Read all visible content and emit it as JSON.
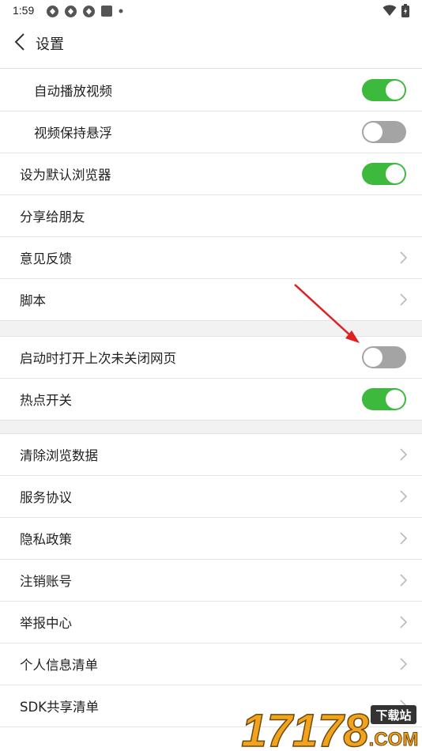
{
  "status_bar": {
    "time": "1:59",
    "left_icons": [
      "app-icon",
      "app-icon",
      "app-icon",
      "square-icon",
      "dot-icon"
    ],
    "right_icons": [
      "wifi-icon",
      "battery-icon"
    ]
  },
  "header": {
    "title": "设置",
    "back_icon": "chevron-left-icon"
  },
  "settings": {
    "group1": [
      {
        "label": "自动播放视频",
        "control": "toggle",
        "state": "on",
        "indent": true
      },
      {
        "label": "视频保持悬浮",
        "control": "toggle",
        "state": "off",
        "indent": true
      },
      {
        "label": "设为默认浏览器",
        "control": "toggle",
        "state": "on",
        "indent": false
      },
      {
        "label": "分享给朋友",
        "control": "none",
        "indent": false
      },
      {
        "label": "意见反馈",
        "control": "chevron",
        "indent": false
      },
      {
        "label": "脚本",
        "control": "chevron",
        "indent": false
      }
    ],
    "group2": [
      {
        "label": "启动时打开上次未关闭网页",
        "control": "toggle",
        "state": "off"
      },
      {
        "label": "热点开关",
        "control": "toggle",
        "state": "on"
      }
    ],
    "group3": [
      {
        "label": "清除浏览数据",
        "control": "chevron"
      },
      {
        "label": "服务协议",
        "control": "chevron"
      },
      {
        "label": "隐私政策",
        "control": "chevron"
      },
      {
        "label": "注销账号",
        "control": "chevron"
      },
      {
        "label": "举报中心",
        "control": "chevron"
      },
      {
        "label": "个人信息清单",
        "control": "chevron"
      },
      {
        "label": "SDK共享清单",
        "control": "chevron"
      }
    ]
  },
  "annotation": {
    "icon": "red-arrow-icon",
    "color": "#e02020"
  },
  "watermark": {
    "text": "17178",
    "badge": "下载站",
    "suffix": ".COM"
  },
  "colors": {
    "toggle_on": "#3dba3d",
    "toggle_off": "#a4a4a4",
    "divider": "#e4e4e4",
    "section_gap": "#f2f2f2"
  }
}
